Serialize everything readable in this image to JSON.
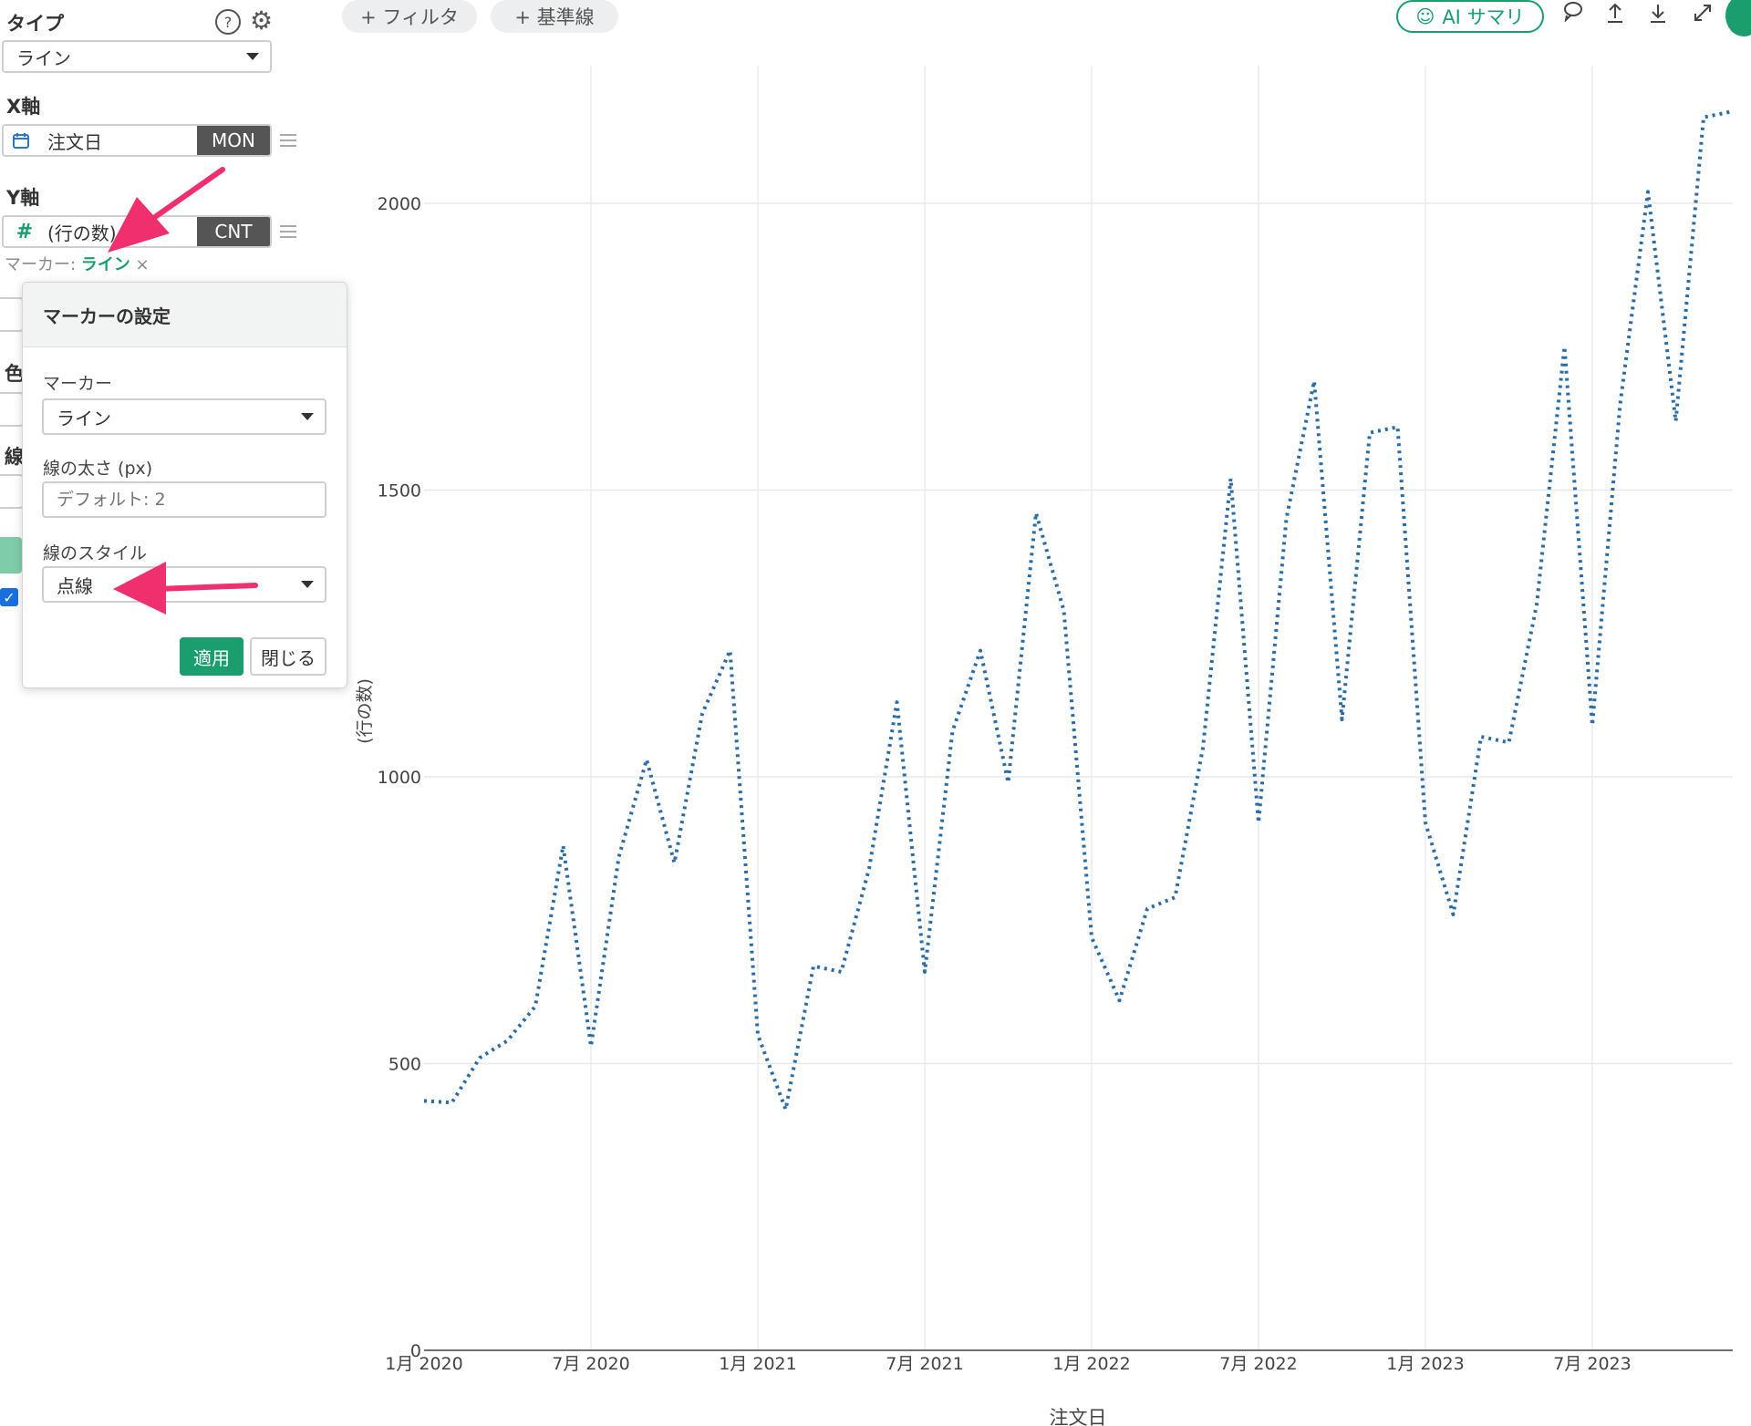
{
  "sidebar": {
    "type_label": "タイプ",
    "type_value": "ライン",
    "x_axis_label": "X軸",
    "x_field": "注文日",
    "x_agg": "MON",
    "y_axis_label": "Y軸",
    "y_field": "(行の数)",
    "y_agg": "CNT",
    "marker_prefix": "マーカー: ",
    "marker_value": "ライン",
    "marker_remove": "×",
    "partial_labels": [
      "色",
      "線"
    ]
  },
  "toolbar": {
    "filter_label": "+ フィルタ",
    "reference_line_label": "+ 基準線",
    "ai_summary_label": "AI サマリ"
  },
  "popup": {
    "title": "マーカーの設定",
    "marker_label": "マーカー",
    "marker_value": "ライン",
    "width_label": "線の太さ (px)",
    "width_placeholder": "デフォルト: 2",
    "style_label": "線のスタイル",
    "style_value": "点線",
    "apply_label": "適用",
    "close_label": "閉じる"
  },
  "colors": {
    "accent_green": "#1a9e6e",
    "series_blue": "#2a6ca6",
    "annotation_pink": "#f0306e"
  },
  "chart_data": {
    "type": "line",
    "line_style": "dotted",
    "xlabel": "注文日",
    "ylabel": "(行の数)",
    "ylim": [
      0,
      2200
    ],
    "yticks": [
      0,
      500,
      1000,
      1500,
      2000
    ],
    "xtick_labels": [
      "1月 2020",
      "7月 2020",
      "1月 2021",
      "7月 2021",
      "1月 2022",
      "7月 2022",
      "1月 2023",
      "7月 2023"
    ],
    "grid": true,
    "x": [
      "2020-01",
      "2020-02",
      "2020-03",
      "2020-04",
      "2020-05",
      "2020-06",
      "2020-07",
      "2020-08",
      "2020-09",
      "2020-10",
      "2020-11",
      "2020-12",
      "2021-01",
      "2021-02",
      "2021-03",
      "2021-04",
      "2021-05",
      "2021-06",
      "2021-07",
      "2021-08",
      "2021-09",
      "2021-10",
      "2021-11",
      "2021-12",
      "2022-01",
      "2022-02",
      "2022-03",
      "2022-04",
      "2022-05",
      "2022-06",
      "2022-07",
      "2022-08",
      "2022-09",
      "2022-10",
      "2022-11",
      "2022-12",
      "2023-01",
      "2023-02",
      "2023-03",
      "2023-04",
      "2023-05",
      "2023-06",
      "2023-07",
      "2023-08",
      "2023-09",
      "2023-10",
      "2023-11",
      "2023-12"
    ],
    "series": [
      {
        "values": [
          435,
          432,
          510,
          540,
          600,
          880,
          530,
          860,
          1030,
          850,
          1110,
          1220,
          550,
          420,
          670,
          660,
          840,
          1130,
          660,
          1080,
          1220,
          990,
          1460,
          1290,
          720,
          610,
          770,
          790,
          1050,
          1520,
          920,
          1450,
          1690,
          1100,
          1600,
          1610,
          920,
          760,
          1070,
          1060,
          1300,
          1750,
          1090,
          1650,
          2020,
          1620,
          2150,
          2160
        ]
      }
    ]
  }
}
